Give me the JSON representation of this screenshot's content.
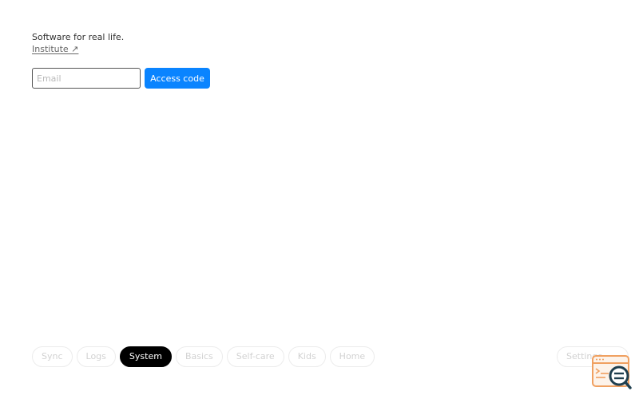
{
  "header": {
    "tagline": "Software for real life.",
    "institute_link": "Institute ↗"
  },
  "login": {
    "email_placeholder": "Email",
    "email_value": "",
    "submit_label": "Access code",
    "accent_color": "#0a84ff"
  },
  "tabs": {
    "items": [
      {
        "label": "Sync",
        "active": false
      },
      {
        "label": "Logs",
        "active": false
      },
      {
        "label": "System",
        "active": true
      },
      {
        "label": "Basics",
        "active": false
      },
      {
        "label": "Self-care",
        "active": false
      },
      {
        "label": "Kids",
        "active": false
      },
      {
        "label": "Home",
        "active": false
      }
    ],
    "settings_label": "Settings"
  },
  "overlay": {
    "icon": "browser-search-icon",
    "color": "#f0a060"
  }
}
